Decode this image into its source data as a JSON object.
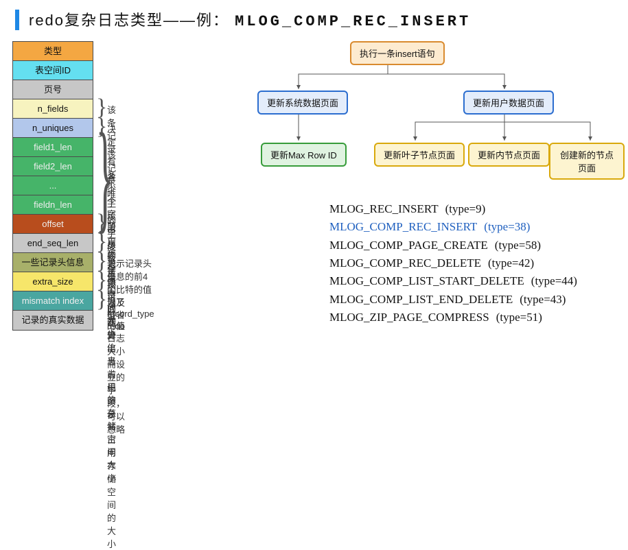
{
  "title_prefix": "redo复杂日志类型——例：",
  "title_code": "MLOG_COMP_REC_INSERT",
  "stack": [
    {
      "label": "类型",
      "cls": "c-orange",
      "note": ""
    },
    {
      "label": "表空间ID",
      "cls": "c-cyan",
      "note": ""
    },
    {
      "label": "页号",
      "cls": "c-grey",
      "note": ""
    },
    {
      "label": "n_fields",
      "cls": "c-lyellow",
      "note": "该条记录有多少个字段"
    },
    {
      "label": "n_uniques",
      "cls": "c-lblue",
      "note": "决定该记录唯一的字段数量"
    },
    {
      "label": "field1_len",
      "cls": "c-green",
      "note": ""
    },
    {
      "label": "field2_len",
      "cls": "c-green",
      "note": ""
    },
    {
      "label": "...",
      "cls": "c-green",
      "note": ""
    },
    {
      "label": "fieldn_len",
      "cls": "c-green",
      "note": ""
    },
    {
      "label": "offset",
      "cls": "c-rust",
      "note": "前一条记录的地址"
    },
    {
      "label": "end_seq_len",
      "cls": "c-grey",
      "note": "从该字段可以计算出当前记录总共占用存储空间的大小"
    },
    {
      "label": "一些记录头信息",
      "cls": "c-olive",
      "note": "表示记录头信息的前4个比特的值以及record_type的值"
    },
    {
      "label": "extra_size",
      "cls": "c-hyellow",
      "note": "记录的额外信息占用的存储空间大小"
    },
    {
      "label": "mismatch index",
      "cls": "c-teal",
      "note": "为了节省redo日志大小而设立的字段，可以忽略"
    },
    {
      "label": "记录的真实数据",
      "cls": "c-grey",
      "note": ""
    }
  ],
  "group_note": "各个字段占用的存储空间大小",
  "flow": {
    "root": "执行一条insert语句",
    "left": "更新系统数据页面",
    "right": "更新用户数据页面",
    "left_child": "更新Max Row ID",
    "rchild1": "更新叶子节点页面",
    "rchild2": "更新内节点页面",
    "rchild3": "创建新的节点页面"
  },
  "types": [
    {
      "name": "MLOG_REC_INSERT",
      "code": "(type=9)",
      "hl": false
    },
    {
      "name": "MLOG_COMP_REC_INSERT",
      "code": "(type=38)",
      "hl": true
    },
    {
      "name": "MLOG_COMP_PAGE_CREATE",
      "code": "(type=58)",
      "hl": false
    },
    {
      "name": "MLOG_COMP_REC_DELETE",
      "code": "(type=42)",
      "hl": false
    },
    {
      "name": "MLOG_COMP_LIST_START_DELETE",
      "code": "(type=44)",
      "hl": false
    },
    {
      "name": "MLOG_COMP_LIST_END_DELETE",
      "code": "(type=43)",
      "hl": false
    },
    {
      "name": "MLOG_ZIP_PAGE_COMPRESS",
      "code": "(type=51)",
      "hl": false
    }
  ]
}
